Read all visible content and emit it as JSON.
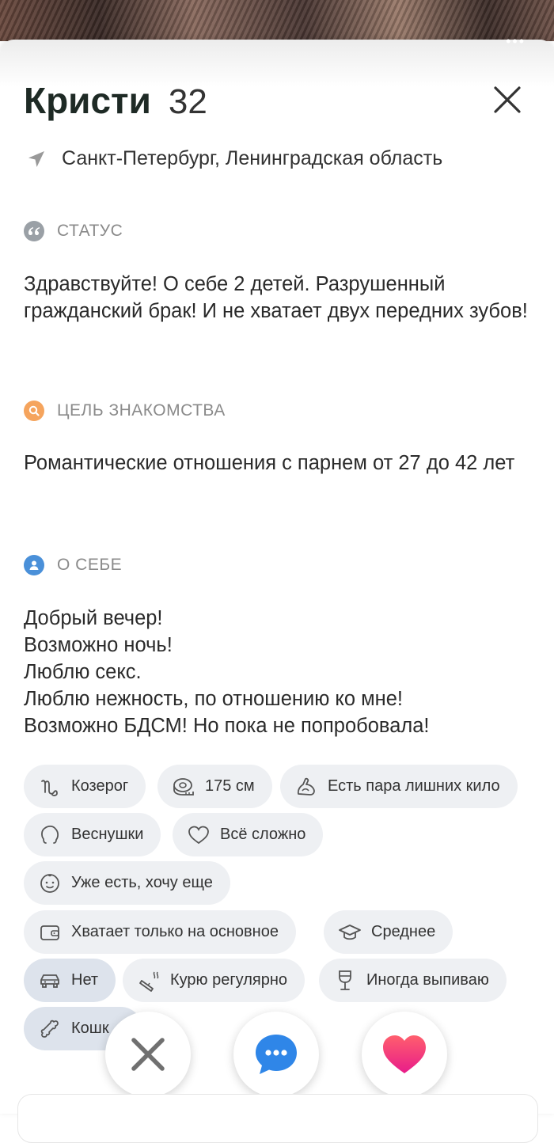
{
  "profile": {
    "name": "Кристи",
    "age": "32",
    "location": "Санкт-Петербург, Ленинградская область"
  },
  "top": {
    "more_dots": "•••"
  },
  "sections": {
    "status": {
      "title": "СТАТУС",
      "icon": "quote-icon",
      "text": "Здравствуйте! О себе 2 детей. Разрушенный гражданский брак! И не хватает двух передних зубов!"
    },
    "goal": {
      "title": "ЦЕЛЬ ЗНАКОМСТВА",
      "icon": "search-icon",
      "text": "Романтические отношения с парнем от 27 до 42 лет"
    },
    "about": {
      "title": "О СЕБЕ",
      "icon": "person-icon",
      "lines": [
        "Добрый вечер!",
        "Возможно ночь!",
        "Люблю секс.",
        "Люблю нежность, по отношению ко мне!",
        "Возможно БДСМ! Но пока не попробовала!"
      ]
    }
  },
  "chips": [
    {
      "label": "Козерог",
      "icon": "capricorn-icon"
    },
    {
      "label": "175 см",
      "icon": "tape-measure-icon"
    },
    {
      "label": "Есть пара лишних кило",
      "icon": "weight-icon"
    },
    {
      "label": "Веснушки",
      "icon": "face-outline-icon"
    },
    {
      "label": "Всё сложно",
      "icon": "heart-outline-icon"
    },
    {
      "label": "Уже есть, хочу еще",
      "icon": "baby-icon"
    },
    {
      "label": "Хватает только на основное",
      "icon": "wallet-icon"
    },
    {
      "label": "Среднее",
      "icon": "graduation-cap-icon"
    },
    {
      "label": "Нет",
      "icon": "car-icon"
    },
    {
      "label": "Курю регулярно",
      "icon": "cigarette-icon"
    },
    {
      "label": "Иногда выпиваю",
      "icon": "wine-glass-icon"
    },
    {
      "label": "Кошк",
      "icon": "bone-icon"
    }
  ],
  "colors": {
    "status_icon": "#9aa0a6",
    "goal_icon": "#f5a45d",
    "about_icon": "#4a90d9",
    "chat_button": "#2f86e8",
    "like_gradient_start": "#ff5f6d",
    "like_gradient_end": "#e81c8a",
    "dislike_icon": "#707070"
  }
}
